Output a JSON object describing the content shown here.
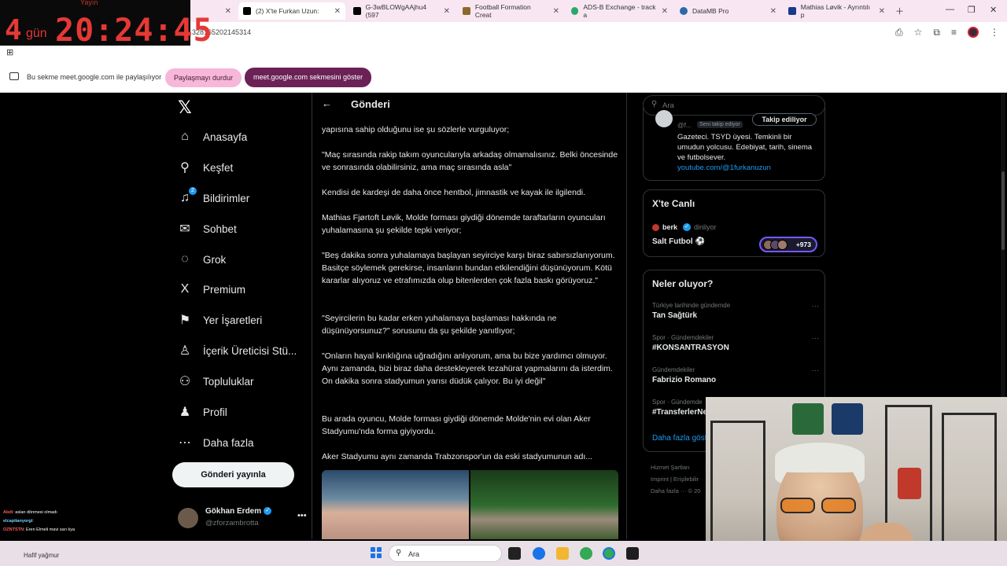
{
  "timer": {
    "label": "Yayın",
    "days": "4",
    "days_label": "gün",
    "clock": "20:24:45"
  },
  "browser": {
    "tabs": [
      {
        "label": "(2) X'te Furkan Uzun: ",
        "color": "#000000"
      },
      {
        "label": "G-3wBLOWgAAjhu4 (597",
        "color": "#000000"
      },
      {
        "label": "Football Formation Creat",
        "color": "#8a6a2a"
      },
      {
        "label": "ADS-B Exchange - track a",
        "color": "#2aa86a"
      },
      {
        "label": "DataMB Pro",
        "color": "#2a6aa8"
      },
      {
        "label": "Mathias Løvik - Ayrıntılı p",
        "color": "#1a3a8a"
      }
    ],
    "url": "328165202145314",
    "share_text": "Bu sekme meet.google.com ile paylaşılıyor",
    "stop_share": "Paylaşmayı durdur",
    "show_tab": "meet.google.com sekmesini göster"
  },
  "nav": {
    "items": [
      {
        "label": "Anasayfa",
        "icon": "⌂"
      },
      {
        "label": "Keşfet",
        "icon": "⚲"
      },
      {
        "label": "Bildirimler",
        "icon": "♫"
      },
      {
        "label": "Sohbet",
        "icon": "✉"
      },
      {
        "label": "Grok",
        "icon": "◌"
      },
      {
        "label": "Premium",
        "icon": "X"
      },
      {
        "label": "Yer İşaretleri",
        "icon": "⚑"
      },
      {
        "label": "İçerik Üreticisi Stü...",
        "icon": "♙"
      },
      {
        "label": "Topluluklar",
        "icon": "⚇"
      },
      {
        "label": "Profil",
        "icon": "♟"
      },
      {
        "label": "Daha fazla",
        "icon": "⋯"
      }
    ],
    "notif_badge": "2",
    "post_button": "Gönderi yayınla",
    "account": {
      "name": "Gökhan Erdem",
      "handle": "@zforzambrotta"
    }
  },
  "main": {
    "title": "Gönderi",
    "paragraphs": [
      "yapısına sahip olduğunu ise şu sözlerle vurguluyor;",
      "\"Maç sırasında rakip takım oyuncularıyla arkadaş olmamalısınız. Belki öncesinde ve sonrasında olabilirsiniz, ama maç sırasında asla\"",
      "Kendisi de kardeşi de daha önce hentbol, jimnastik ve kayak ile ilgilendi.",
      "Mathias Fjørtoft Løvik, Molde forması giydiği dönemde taraftarların oyuncuları yuhalamasına şu şekilde tepki veriyor;",
      "\"Beş dakika sonra yuhalamaya başlayan seyirciye karşı biraz sabırsızlanıyorum. Basitçe söylemek gerekirse, insanların bundan etkilendiğini düşünüyorum. Kötü kararlar alıyoruz ve etrafımızda olup bitenlerden çok fazla baskı görüyoruz.\"",
      "\"Seyircilerin bu kadar erken yuhalamaya başlaması hakkında ne düşünüyorsunuz?\" sorusunu da şu şekilde yanıtlıyor;",
      "\"Onların hayal kırıklığına uğradığını anlıyorum, ama bu bize yardımcı olmuyor. Aynı zamanda, bizi biraz daha destekleyerek tezahürat yapmalarını da isterdim. On dakika sonra stadyumun yarısı düdük çalıyor. Bu iyi değil\"",
      "Bu arada oyuncu, Molde forması giydiği dönemde Molde'nin evi olan Aker Stadyumu'nda forma giyiyordu.",
      "Aker Stadyumu aynı zamanda Trabzonspor'un da eski stadyumunun adı..."
    ]
  },
  "right": {
    "search_placeholder": "Ara",
    "profile_card": {
      "handle": "@f...",
      "follows_you": "Seni takip ediyor",
      "follow_button": "Takip ediliyor",
      "bio": "Gazeteci. TSYD üyesi. Temkinli bir umudun yolcusu. Edebiyat, tarih, sinema ve futbolsever.",
      "link": "youtube.com/@1furkanuzun"
    },
    "live": {
      "title": "X'te Canlı",
      "user": "berk",
      "status": "dinliyor",
      "space_title": "Salt Futbol ⚽",
      "count": "+973"
    },
    "trends": {
      "title": "Neler oluyor?",
      "items": [
        {
          "meta": "Türkiye tarihinde gündemde",
          "name": "Tan Sağtürk"
        },
        {
          "meta": "Spor · Gündemdekiler",
          "name": "#KONSANTRASYON"
        },
        {
          "meta": "Gündemdekiler",
          "name": "Fabrizio Romano"
        },
        {
          "meta": "Spor · Gündemde",
          "name": "#TransferlerNe"
        }
      ],
      "show_more": "Daha fazla göst"
    },
    "footer": [
      "Hizmet Şartları",
      "Imprint  |  Erişilebilir",
      "Daha fazla ···  © 20"
    ]
  },
  "chat": [
    {
      "user": "Abdi",
      "msg": ": aslan dönmesi olmadı"
    },
    {
      "user": "elcapitanyorgi",
      "msg": ": "
    },
    {
      "user": "OZNTSTN",
      "msg": ": Eren Elmeli mavi sarı kya"
    },
    {
      "user": "",
      "msg": "Hafif yağmur"
    }
  ],
  "taskbar": {
    "search": "Ara"
  }
}
